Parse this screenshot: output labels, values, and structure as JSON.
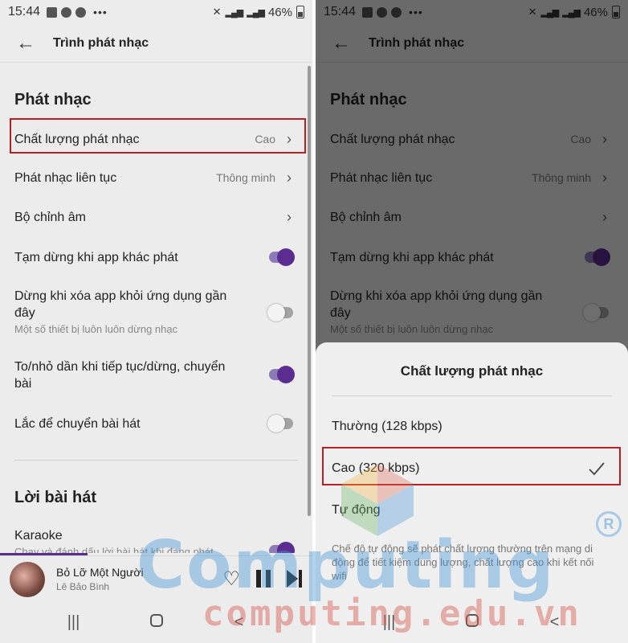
{
  "status_bar": {
    "time": "15:44",
    "dots": "•••",
    "battery": "46%"
  },
  "app_bar": {
    "title": "Trình phát nhạc"
  },
  "sections": {
    "playback": "Phát nhạc",
    "lyrics": "Lời bài hát"
  },
  "settings": {
    "quality": {
      "label": "Chất lượng phát nhạc",
      "value": "Cao"
    },
    "continuous": {
      "label": "Phát nhạc liên tục",
      "value": "Thông minh"
    },
    "equalizer": {
      "label": "Bộ chỉnh âm"
    },
    "pause_other": {
      "label": "Tạm dừng khi app khác phát",
      "enabled": true
    },
    "stop_on_clear": {
      "label": "Dừng khi xóa app khỏi ứng dụng gần đây",
      "sub": "Một số thiết bị luôn luôn dừng nhạc",
      "enabled": false
    },
    "fade": {
      "label": "To/nhỏ dần khi tiếp tục/dừng, chuyển bài",
      "enabled": true
    },
    "shake": {
      "label": "Lắc để chuyển bài hát",
      "enabled": false
    },
    "karaoke": {
      "label": "Karaoke",
      "sub": "Chạy và đánh dấu lời bài hát khi đang phát",
      "enabled": true
    }
  },
  "player": {
    "song": "Bỏ Lỡ Một Người",
    "artist": "Lê Bảo Bình",
    "progress": 0.28
  },
  "nav": {
    "recent": "|||",
    "back": "<"
  },
  "sheet": {
    "title": "Chất lượng phát nhạc",
    "options": [
      "Thường (128 kbps)",
      "Cao (320 kbps)",
      "Tự động"
    ],
    "selected": "Cao (320 kbps)",
    "description": "Chế độ tự động sẽ phát chất lượng thường trên mạng di động để tiết kiệm dung lượng, chất lượng cao khi kết nối wifi"
  },
  "watermark": {
    "brand": "Computing",
    "domain": "computing.edu.vn",
    "reg_mark": "R"
  },
  "colors": {
    "accent": "#5c2d91",
    "highlight": "#b61f24",
    "background": "#ececec"
  }
}
